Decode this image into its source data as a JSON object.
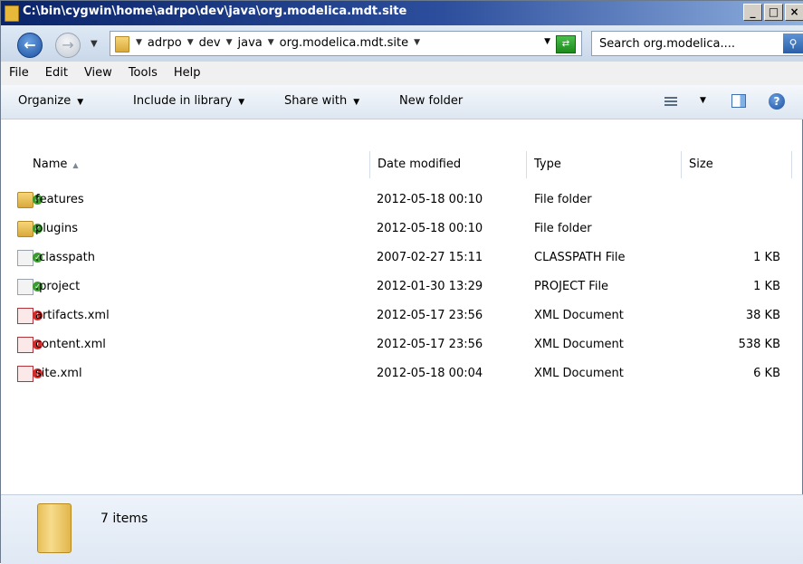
{
  "window": {
    "title": "C:\\bin\\cygwin\\home\\adrpo\\dev\\java\\org.modelica.mdt.site",
    "buttons": {
      "minimize": "_",
      "maximize": "□",
      "close": "×"
    }
  },
  "address_bar": {
    "crumbs": [
      "adrpo",
      "dev",
      "java",
      "org.modelica.mdt.site"
    ],
    "search_text": "Search org.modelica...."
  },
  "menu": [
    "File",
    "Edit",
    "View",
    "Tools",
    "Help"
  ],
  "toolbar": {
    "organize": "Organize",
    "include_in_library": "Include in library",
    "share_with": "Share with",
    "new_folder": "New folder"
  },
  "columns": {
    "name": "Name",
    "date_modified": "Date modified",
    "type": "Type",
    "size": "Size"
  },
  "files": [
    {
      "name": "features",
      "date": "2012-05-18 00:10",
      "type": "File folder",
      "size": "",
      "icon": "folder-icon"
    },
    {
      "name": "plugins",
      "date": "2012-05-18 00:10",
      "type": "File folder",
      "size": "",
      "icon": "folder-icon"
    },
    {
      "name": ".classpath",
      "date": "2007-02-27 15:11",
      "type": "CLASSPATH File",
      "size": "1 KB",
      "icon": "file-icon"
    },
    {
      "name": ".project",
      "date": "2012-01-30 13:29",
      "type": "PROJECT File",
      "size": "1 KB",
      "icon": "file-icon"
    },
    {
      "name": "artifacts.xml",
      "date": "2012-05-17 23:56",
      "type": "XML Document",
      "size": "38 KB",
      "icon": "xml-file-icon"
    },
    {
      "name": "content.xml",
      "date": "2012-05-17 23:56",
      "type": "XML Document",
      "size": "538 KB",
      "icon": "xml-file-icon"
    },
    {
      "name": "site.xml",
      "date": "2012-05-18 00:04",
      "type": "XML Document",
      "size": "6 KB",
      "icon": "xml-file-icon"
    }
  ],
  "details": {
    "items_count": "7 items"
  },
  "colors": {
    "title_bar": "#0a246a",
    "command_bar": "#dde6f1",
    "details_pane": "#dfe8f4"
  }
}
